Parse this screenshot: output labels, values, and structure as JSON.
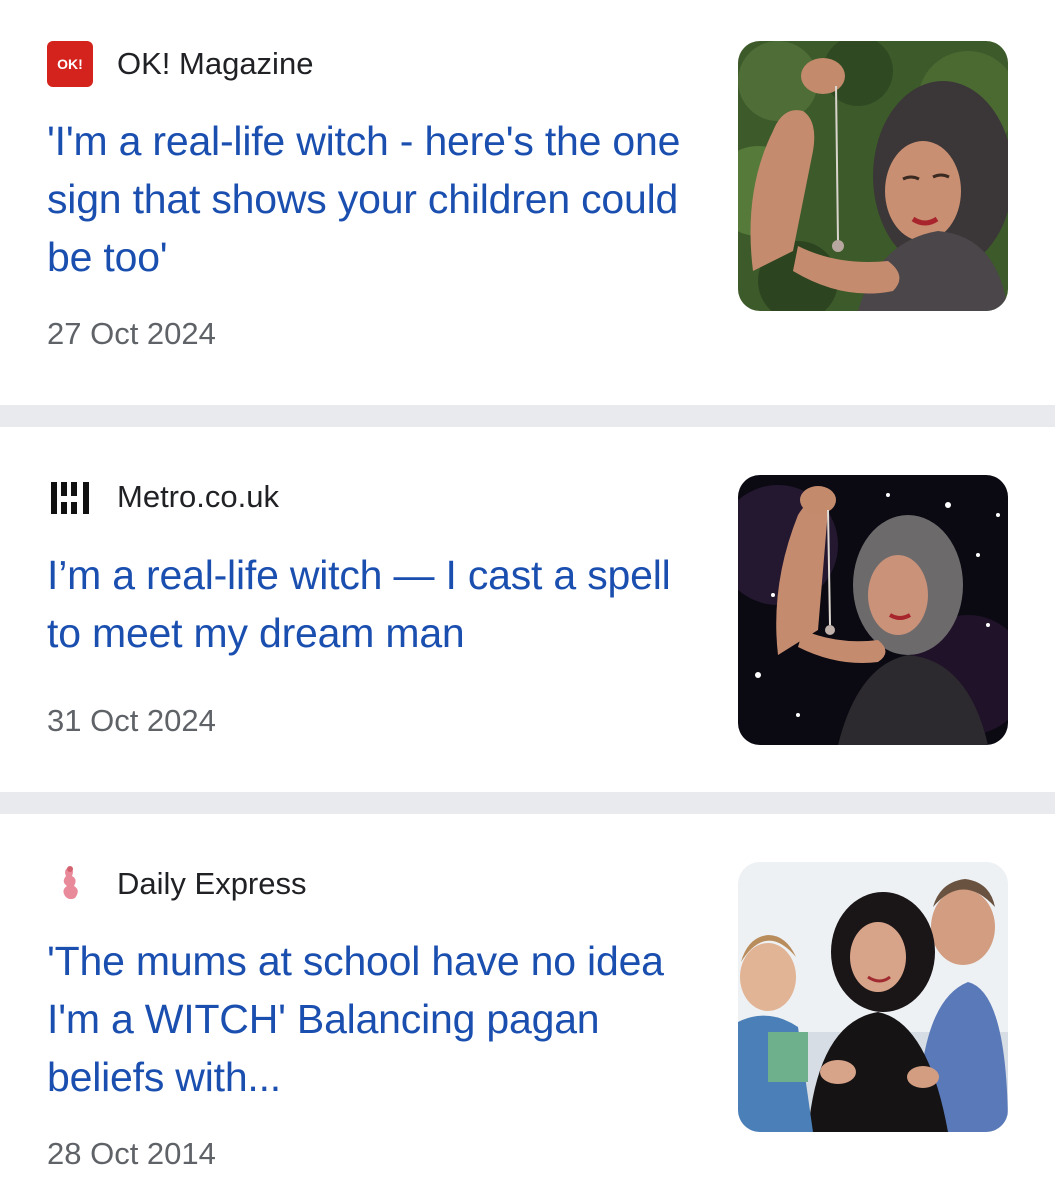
{
  "articles": [
    {
      "source": "OK! Magazine",
      "logo_icon": "ok-magazine-logo",
      "logo_text": "OK!",
      "headline": "'I'm a real-life witch - here's the one sign that shows your children could be too'",
      "date": "27 Oct 2024",
      "thumbnail": "woman-with-pendulum-garden"
    },
    {
      "source": "Metro.co.uk",
      "logo_icon": "metro-logo",
      "headline": "I’m a real-life witch — I cast a spell to meet my dream man",
      "date": "31 Oct 2024",
      "thumbnail": "woman-with-pendulum-starry-background"
    },
    {
      "source": "Daily Express",
      "logo_icon": "daily-express-logo",
      "headline": "'The mums at school have no idea I'm a WITCH' Balancing pagan beliefs with...",
      "date": "28 Oct 2014",
      "thumbnail": "family-portrait-on-sofa"
    }
  ],
  "colors": {
    "headline": "#1a4fb0",
    "source": "#202124",
    "date": "#5f6368",
    "divider": "#e8eaed",
    "ok_logo": "#d3231c"
  }
}
